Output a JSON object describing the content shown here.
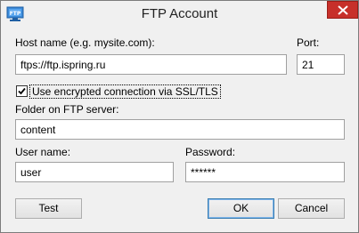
{
  "window": {
    "title": "FTP Account",
    "icon": "ftp-icon",
    "icon_text": "FTP"
  },
  "form": {
    "host_label": "Host name (e.g. mysite.com):",
    "host_value": "ftps://ftp.ispring.ru",
    "port_label": "Port:",
    "port_value": "21",
    "ssl_label": "Use encrypted connection via SSL/TLS",
    "ssl_checked": true,
    "folder_label": "Folder on FTP server:",
    "folder_value": "content",
    "user_label": "User name:",
    "user_value": "user",
    "password_label": "Password:",
    "password_value": "******"
  },
  "buttons": {
    "test": "Test",
    "ok": "OK",
    "cancel": "Cancel"
  },
  "colors": {
    "close_button": "#c7302a",
    "default_button_border": "#3c7fb1"
  }
}
